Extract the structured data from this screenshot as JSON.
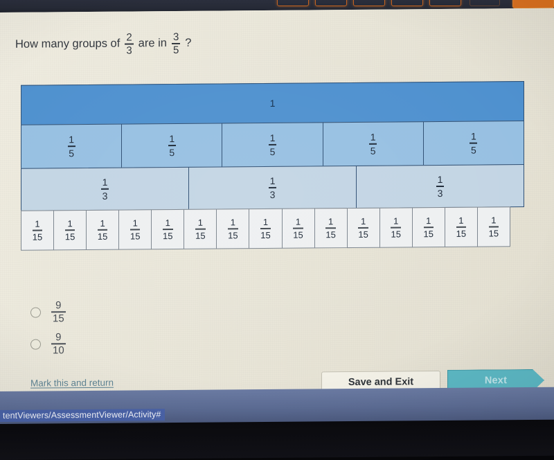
{
  "browser": {
    "status_url": "tentViewers/AssessmentViewer/Activity#"
  },
  "question": {
    "prefix": "How many groups of",
    "fraction_a": {
      "numerator": "2",
      "denominator": "3"
    },
    "middle": "are in",
    "fraction_b": {
      "numerator": "3",
      "denominator": "5"
    },
    "suffix": "?"
  },
  "model": {
    "whole_label": "1",
    "rows": [
      {
        "name": "whole",
        "count": 1,
        "numerator": "",
        "denominator": "",
        "label": "1",
        "color": "#4f91cf"
      },
      {
        "name": "fifths",
        "count": 5,
        "numerator": "1",
        "denominator": "5",
        "color": "#97c0e2"
      },
      {
        "name": "thirds",
        "count": 3,
        "numerator": "1",
        "denominator": "3",
        "color": "#c3d5e4"
      },
      {
        "name": "fifteenths",
        "count": 15,
        "numerator": "1",
        "denominator": "15",
        "color": "#eef0f1"
      }
    ]
  },
  "options": [
    {
      "numerator": "9",
      "denominator": "15",
      "selected": false
    },
    {
      "numerator": "9",
      "denominator": "10",
      "selected": false
    }
  ],
  "footer": {
    "mark_link": "Mark this and return",
    "save_label": "Save and Exit",
    "next_label": "Next"
  },
  "colors": {
    "whole": "#4f91cf",
    "fifths": "#97c0e2",
    "thirds": "#c3d5e4",
    "fifteenths": "#eef0f1",
    "next_button": "#5cb8c4",
    "link": "#5f8494",
    "page_bg": "#e9e6d9",
    "taskbar": "#5d6d95"
  }
}
